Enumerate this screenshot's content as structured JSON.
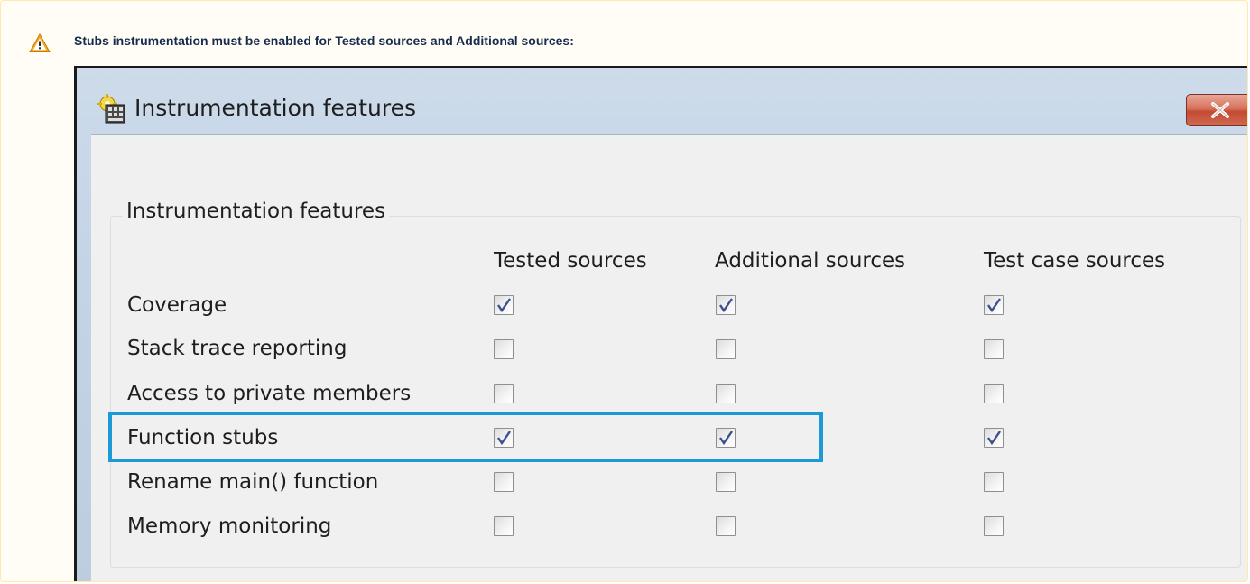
{
  "note": {
    "text": "Stubs instrumentation must be enabled for Tested sources and Additional sources:",
    "icon": "warning-icon",
    "accent": "#f5a623"
  },
  "dialog": {
    "title": "Instrumentation features",
    "close_icon": "close-icon",
    "group_title": "Instrumentation features",
    "columns": [
      "Tested sources",
      "Additional sources",
      "Test case sources"
    ],
    "rows": [
      {
        "label": "Coverage",
        "checks": [
          true,
          true,
          true
        ]
      },
      {
        "label": "Stack trace reporting",
        "checks": [
          false,
          false,
          false
        ]
      },
      {
        "label": "Access to private members",
        "checks": [
          false,
          false,
          false
        ]
      },
      {
        "label": "Function stubs",
        "checks": [
          true,
          true,
          true
        ]
      },
      {
        "label": "Rename main() function",
        "checks": [
          false,
          false,
          false
        ]
      },
      {
        "label": "Memory monitoring",
        "checks": [
          false,
          false,
          false
        ]
      }
    ],
    "highlighted_row": "Function stubs",
    "highlight_color": "#1c9ad6"
  }
}
